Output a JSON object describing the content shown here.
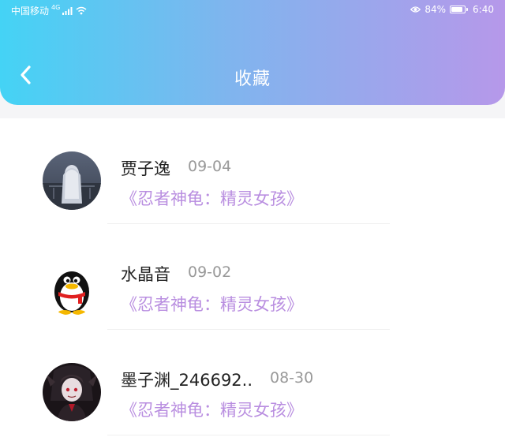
{
  "status_bar": {
    "carrier": "中国移动",
    "network": "4G",
    "battery": "84%",
    "time": "6:40"
  },
  "header": {
    "title": "收藏"
  },
  "colors": {
    "header_gradient_start": "#44d3f5",
    "header_gradient_end": "#b698ea",
    "work_title": "#b98ee0"
  },
  "favorites": [
    {
      "name": "贾子逸",
      "date": "09-04",
      "work": "《忍者神龟：精灵女孩》",
      "avatar": "ghost-girl-avatar"
    },
    {
      "name": "水晶音",
      "date": "09-02",
      "work": "《忍者神龟：精灵女孩》",
      "avatar": "penguin-avatar"
    },
    {
      "name": "墨子渊_246692..",
      "date": "08-30",
      "work": "《忍者神龟：精灵女孩》",
      "avatar": "dark-character-avatar"
    }
  ]
}
